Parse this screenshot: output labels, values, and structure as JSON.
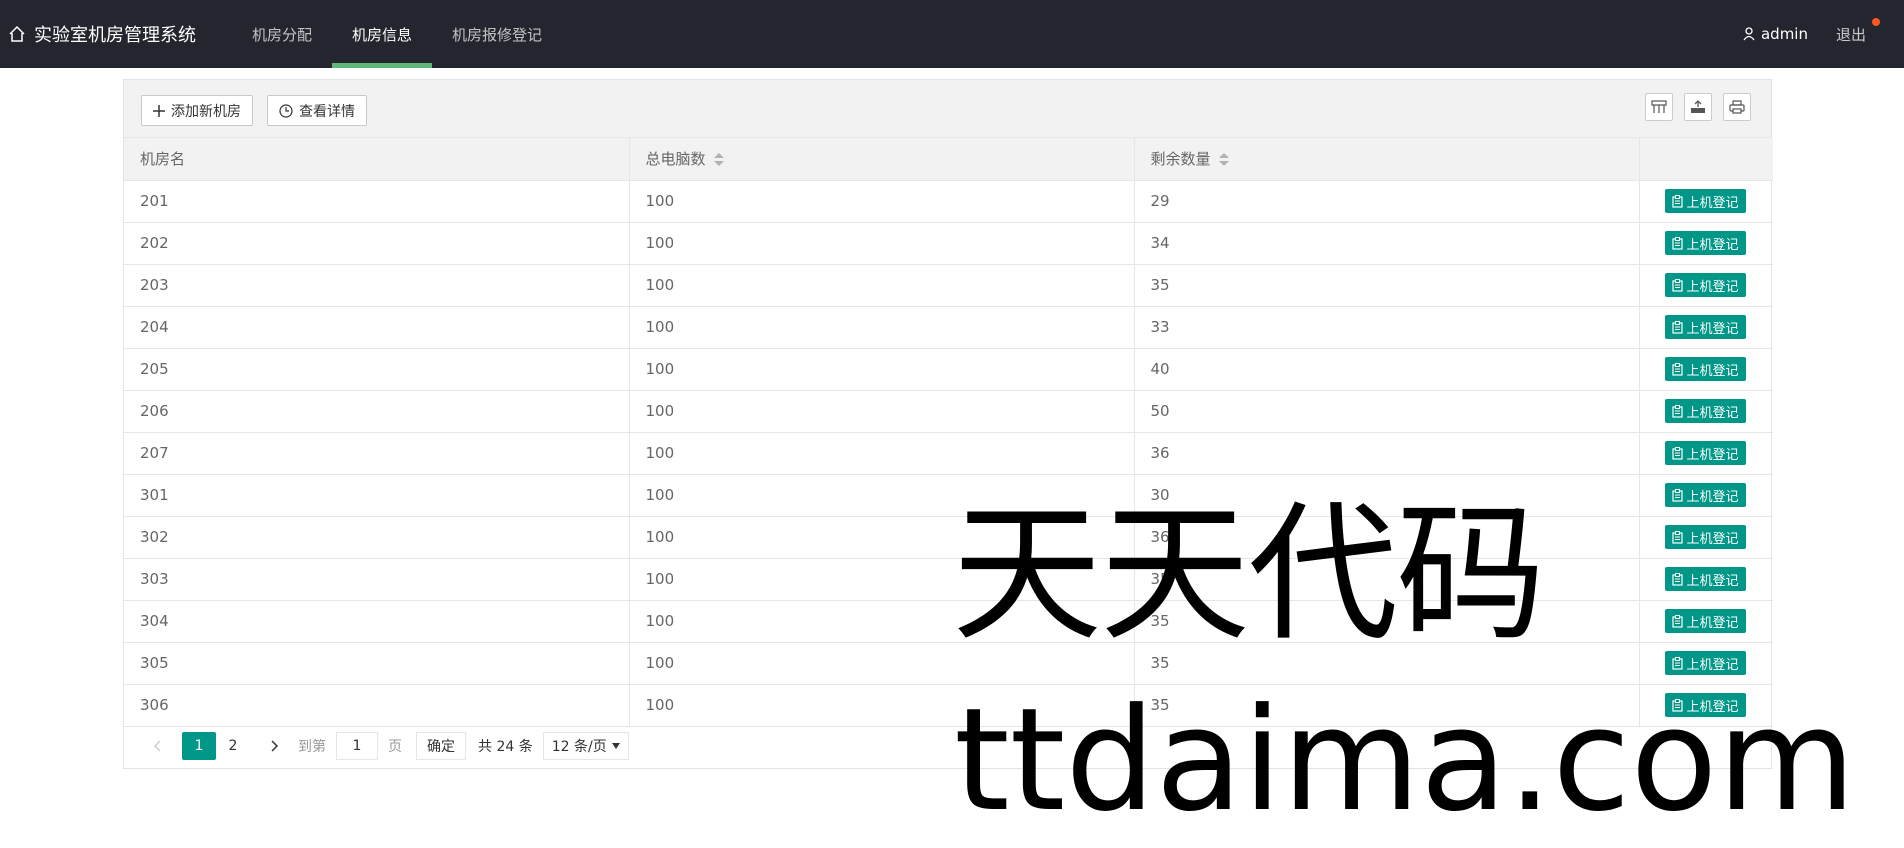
{
  "app": {
    "title": "实验室机房管理系统"
  },
  "nav": [
    {
      "label": "机房分配",
      "active": false
    },
    {
      "label": "机房信息",
      "active": true
    },
    {
      "label": "机房报修登记",
      "active": false
    }
  ],
  "user": {
    "name": "admin",
    "logout": "退出"
  },
  "toolbar": {
    "add_label": "添加新机房",
    "detail_label": "查看详情"
  },
  "table": {
    "headers": [
      "机房名",
      "总电脑数",
      "剩余数量",
      ""
    ],
    "action_label": "上机登记",
    "rows": [
      [
        "201",
        "100",
        "29"
      ],
      [
        "202",
        "100",
        "34"
      ],
      [
        "203",
        "100",
        "35"
      ],
      [
        "204",
        "100",
        "33"
      ],
      [
        "205",
        "100",
        "40"
      ],
      [
        "206",
        "100",
        "50"
      ],
      [
        "207",
        "100",
        "36"
      ],
      [
        "301",
        "100",
        "30"
      ],
      [
        "302",
        "100",
        "36"
      ],
      [
        "303",
        "100",
        "35"
      ],
      [
        "304",
        "100",
        "35"
      ],
      [
        "305",
        "100",
        "35"
      ],
      [
        "306",
        "100",
        "35"
      ]
    ]
  },
  "pagination": {
    "pages": [
      "1",
      "2"
    ],
    "current": "1",
    "goto_label": "到第",
    "goto_value": "1",
    "page_unit": "页",
    "confirm_label": "确定",
    "total_label": "共 24 条",
    "page_size_label": "12 条/页"
  },
  "watermark": {
    "line1": "天天代码",
    "line2": "ttdaima.com"
  },
  "colors": {
    "topbar": "#23262e",
    "accent": "#009688",
    "nav_indicator": "#5fb878",
    "badge": "#ff5722"
  }
}
